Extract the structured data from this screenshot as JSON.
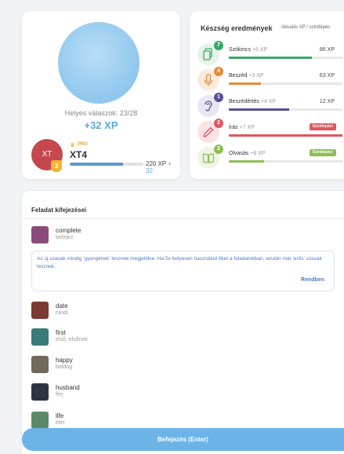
{
  "result": {
    "correct_label": "Helyes válaszok: 23/28",
    "xp_gain": "+32 XP",
    "avatar_initials": "XT",
    "level": "3",
    "pro_label": "PRO",
    "username": "XT4",
    "xp_total": "220 XP",
    "xp_plus": "+ 32",
    "xp_progress": 0.72
  },
  "skills": {
    "title": "Készség eredmények",
    "subtitle": "Aktuális XP / szintlépés",
    "items": [
      {
        "name": "Szókincs",
        "xp": "+6 XP",
        "value": "86 XP",
        "badge": "7",
        "color": "#3aa76d",
        "bg": "#e4f4ea",
        "icon": "cards-icon",
        "progress": 0.73
      },
      {
        "name": "Beszéd",
        "xp": "+3 XP",
        "value": "63 XP",
        "badge": "4",
        "color": "#e98a3a",
        "bg": "#fcebdc",
        "icon": "microphone-icon",
        "progress": 0.28
      },
      {
        "name": "Beszédértés",
        "xp": "+4 XP",
        "value": "12 XP",
        "badge": "1",
        "color": "#5a4f9b",
        "bg": "#e9e7f4",
        "icon": "ear-icon",
        "progress": 0.53
      },
      {
        "name": "Írás",
        "xp": "+7 XP",
        "tag": "Szintlépés!",
        "badge": "2",
        "color": "#e0565d",
        "bg": "#fbe3e4",
        "icon": "pencil-icon",
        "progress": 1.0
      },
      {
        "name": "Olvasás",
        "xp": "+8 XP",
        "tag": "Szintlépés!",
        "badge": "2",
        "color": "#8ebd57",
        "bg": "#eef5e4",
        "icon": "book-icon",
        "progress": 0.31
      }
    ]
  },
  "expressions": {
    "title": "Feladat kifejezései",
    "notice": "Az új szavak mindig 'gyengének' lesznek megjelölve. Ha 5x helyesen használod őket a feladatokban, azután már 'erős' szavak lesznek.",
    "notice_button": "Rendben",
    "items": [
      {
        "word": "complete",
        "translation": "befejez",
        "color": "#8a4a7a"
      },
      {
        "word": "date",
        "translation": "randi",
        "color": "#7a3a32"
      },
      {
        "word": "first",
        "translation": "első, elsőnek",
        "color": "#3a7a78"
      },
      {
        "word": "happy",
        "translation": "boldog",
        "color": "#6e6a5c"
      },
      {
        "word": "husband",
        "translation": "férj",
        "color": "#2e3444"
      },
      {
        "word": "life",
        "translation": "élet",
        "color": "#5a8a6a"
      }
    ]
  },
  "finish_label": "Befejezés (Enter)"
}
